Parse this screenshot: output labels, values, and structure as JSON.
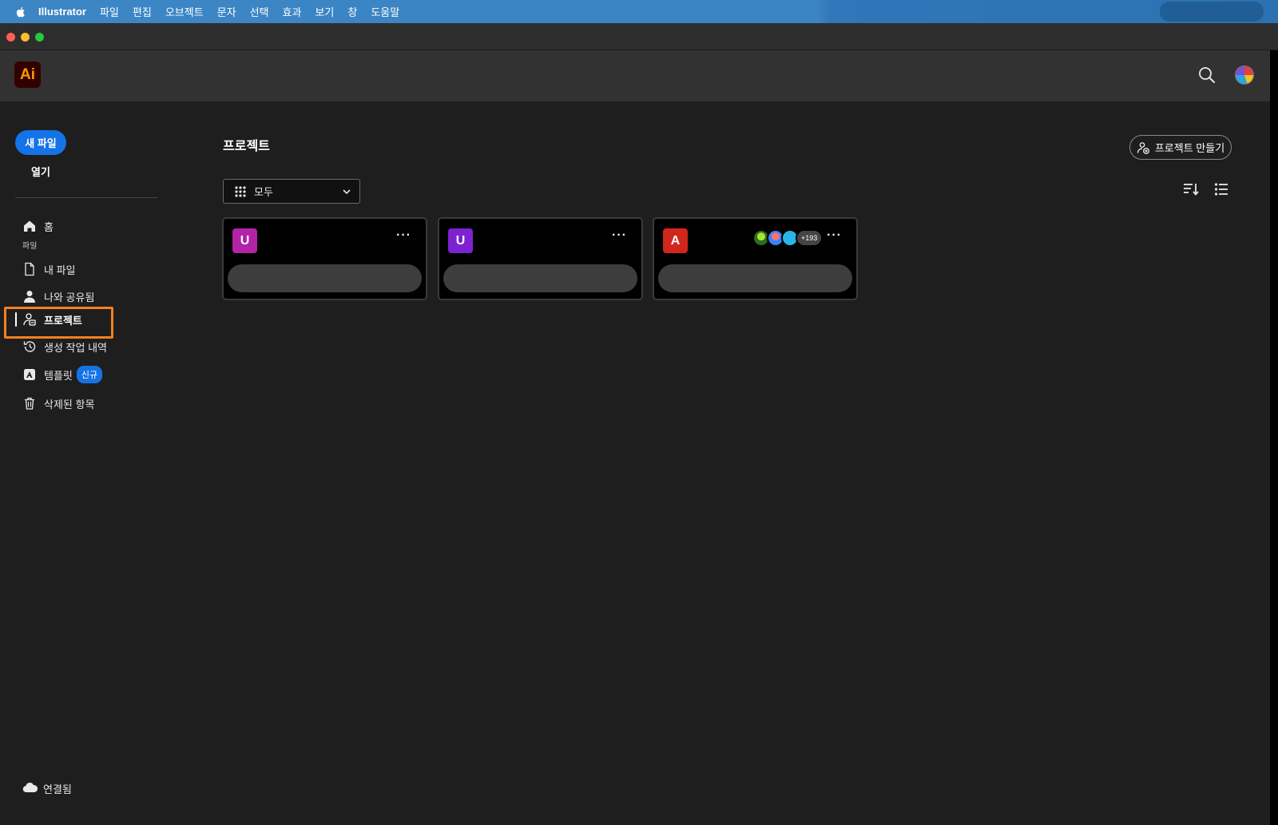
{
  "menubar": {
    "app_name": "Illustrator",
    "items": [
      "파일",
      "편집",
      "오브젝트",
      "문자",
      "선택",
      "효과",
      "보기",
      "창",
      "도움말"
    ]
  },
  "app": {
    "logo_text": "Ai",
    "logo_bg": "#330000",
    "logo_fg": "#ff9a00"
  },
  "sidebar": {
    "new_file": "새 파일",
    "open": "열기",
    "home": "홈",
    "section_files": "파일",
    "my_files": "내 파일",
    "shared_with_me": "나와 공유됨",
    "projects": "프로젝트",
    "generation_history": "생성 작업 내역",
    "templates": "템플릿",
    "templates_badge": "신규",
    "deleted": "삭제된 항목",
    "connected": "연결됨"
  },
  "content": {
    "title": "프로젝트",
    "create_project": "프로젝트 만들기",
    "filter_value": "모두"
  },
  "projects": [
    {
      "initial": "U",
      "color": "#b323a6",
      "more": "···"
    },
    {
      "initial": "U",
      "color": "#7d22d1",
      "more": "···"
    },
    {
      "initial": "A",
      "color": "#d1261c",
      "more": "···",
      "members_extra": "+193"
    }
  ],
  "colors": {
    "accent": "#1473e6",
    "highlight": "#f4811f"
  }
}
